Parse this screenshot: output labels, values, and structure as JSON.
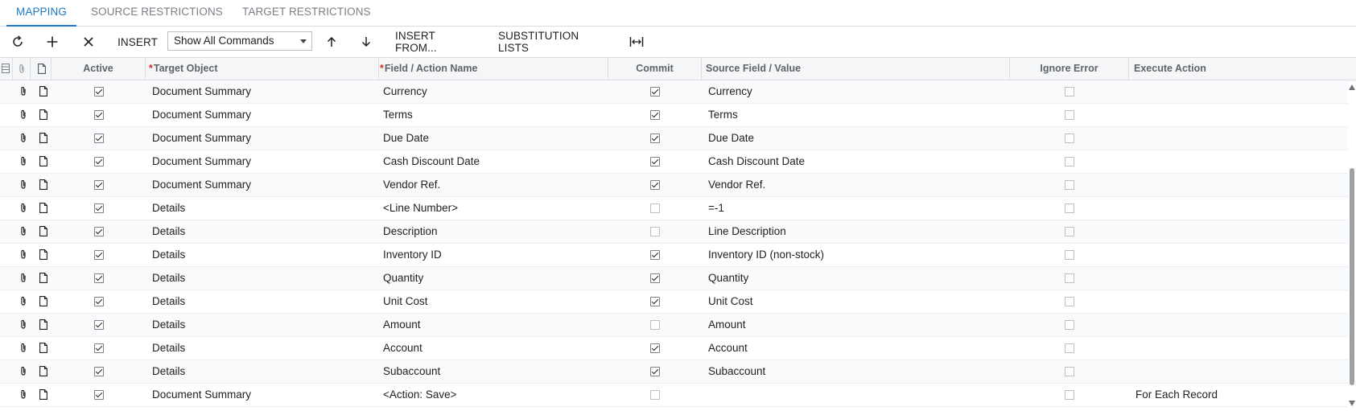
{
  "tabs": [
    {
      "label": "MAPPING",
      "active": true
    },
    {
      "label": "SOURCE RESTRICTIONS",
      "active": false
    },
    {
      "label": "TARGET RESTRICTIONS",
      "active": false
    }
  ],
  "toolbar": {
    "refresh_icon": "refresh-icon",
    "add_icon": "plus-icon",
    "delete_icon": "close-icon",
    "insert_label": "INSERT",
    "commands_select_value": "Show All Commands",
    "move_up_icon": "arrow-up-icon",
    "move_down_icon": "arrow-down-icon",
    "insert_from_label": "INSERT FROM...",
    "substitution_lists_label": "SUBSTITUTION LISTS",
    "fit_columns_icon": "fit-width-icon"
  },
  "grid": {
    "columns": {
      "active": "Active",
      "target_object": "Target Object",
      "field_action_name": "Field / Action Name",
      "commit": "Commit",
      "source_field_value": "Source Field / Value",
      "ignore_error": "Ignore Error",
      "execute_action": "Execute Action"
    },
    "required_mark": "*",
    "rows": [
      {
        "active": true,
        "target": "Document Summary",
        "field": "Currency",
        "commit": true,
        "source": "Currency",
        "ignore_error": false,
        "execute": ""
      },
      {
        "active": true,
        "target": "Document Summary",
        "field": "Terms",
        "commit": true,
        "source": "Terms",
        "ignore_error": false,
        "execute": ""
      },
      {
        "active": true,
        "target": "Document Summary",
        "field": "Due Date",
        "commit": true,
        "source": "Due Date",
        "ignore_error": false,
        "execute": ""
      },
      {
        "active": true,
        "target": "Document Summary",
        "field": "Cash Discount Date",
        "commit": true,
        "source": "Cash Discount Date",
        "ignore_error": false,
        "execute": ""
      },
      {
        "active": true,
        "target": "Document Summary",
        "field": "Vendor Ref.",
        "commit": true,
        "source": "Vendor Ref.",
        "ignore_error": false,
        "execute": ""
      },
      {
        "active": true,
        "target": "Details",
        "field": "<Line Number>",
        "commit": false,
        "commit_disabled": true,
        "source": "=-1",
        "ignore_error": false,
        "execute": ""
      },
      {
        "active": true,
        "target": "Details",
        "field": "Description",
        "commit": false,
        "source": "Line Description",
        "ignore_error": false,
        "execute": ""
      },
      {
        "active": true,
        "target": "Details",
        "field": "Inventory ID",
        "commit": true,
        "source": "Inventory ID (non-stock)",
        "ignore_error": false,
        "execute": ""
      },
      {
        "active": true,
        "target": "Details",
        "field": "Quantity",
        "commit": true,
        "source": "Quantity",
        "ignore_error": false,
        "execute": ""
      },
      {
        "active": true,
        "target": "Details",
        "field": "Unit Cost",
        "commit": true,
        "source": "Unit Cost",
        "ignore_error": false,
        "execute": ""
      },
      {
        "active": true,
        "target": "Details",
        "field": "Amount",
        "commit": false,
        "source": "Amount",
        "ignore_error": false,
        "execute": ""
      },
      {
        "active": true,
        "target": "Details",
        "field": "Account",
        "commit": true,
        "source": "Account",
        "ignore_error": false,
        "execute": ""
      },
      {
        "active": true,
        "target": "Details",
        "field": "Subaccount",
        "commit": true,
        "source": "Subaccount",
        "ignore_error": false,
        "execute": ""
      },
      {
        "active": true,
        "target": "Document Summary",
        "field": "<Action: Save>",
        "commit": false,
        "commit_disabled": true,
        "source": "",
        "ignore_error": false,
        "execute": "For Each Record"
      }
    ]
  },
  "colors": {
    "accent": "#1d78c7",
    "required": "#d32f2f",
    "header_bg": "#f5f6f8",
    "alt_row_bg": "#f8fafc"
  }
}
